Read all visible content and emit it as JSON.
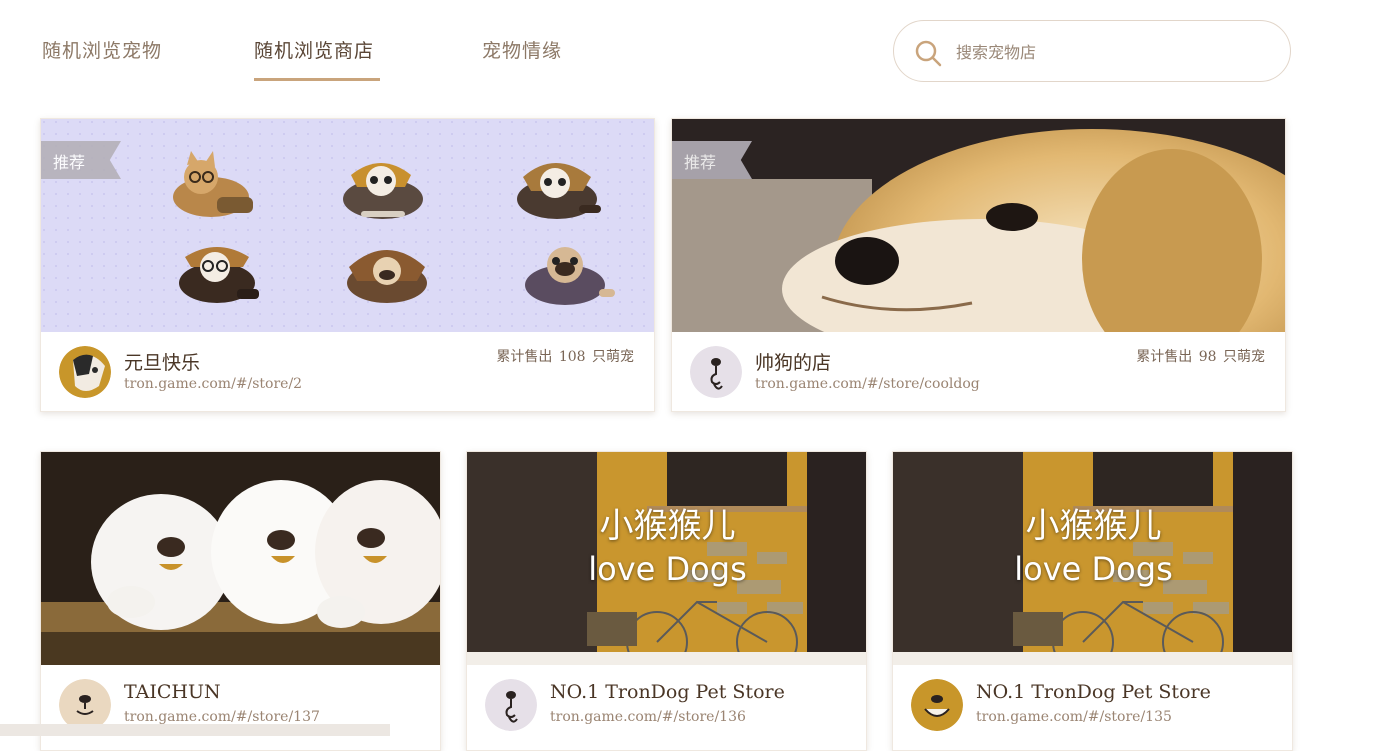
{
  "nav": {
    "tabs": [
      {
        "label": "随机浏览宠物"
      },
      {
        "label": "随机浏览商店"
      },
      {
        "label": "宠物情缘"
      }
    ],
    "active_tab": 1
  },
  "search": {
    "placeholder": "搜索宠物店",
    "value": ""
  },
  "colors": {
    "accent": "#c9a47c",
    "text_dark": "#4a3626",
    "text_muted": "#9a8472",
    "ribbon": "#b4b0b8",
    "lavender_bg": "#dcdaf6",
    "mustard": "#c8962a"
  },
  "stores": [
    {
      "name": "元旦快乐",
      "url": "tron.game.com/#/store/2",
      "sold_prefix": "累计售出",
      "sold_count": "108",
      "sold_suffix": "只萌宠",
      "badge": "推荐",
      "image": "cat-stickers-image",
      "avatar": "dog-avatar-icon"
    },
    {
      "name": "帅狗的店",
      "url": "tron.game.com/#/store/cooldog",
      "sold_prefix": "累计售出",
      "sold_count": "98",
      "sold_suffix": "只萌宠",
      "badge": "推荐",
      "image": "golden-puppy-image",
      "avatar": "dog-nose-icon"
    },
    {
      "name": "TAICHUN",
      "url": "tron.game.com/#/store/137",
      "image": "white-puppies-image",
      "avatar": "dog-face-icon"
    },
    {
      "name": "NO.1 TronDog Pet Store",
      "url": "tron.game.com/#/store/136",
      "image_title_line1": "小猴猴儿",
      "image_title_line2": "love Dogs",
      "image": "yellow-wall-bike-image",
      "avatar": "dog-nose-icon"
    },
    {
      "name": "NO.1 TronDog Pet Store",
      "url": "tron.game.com/#/store/135",
      "image_title_line1": "小猴猴儿",
      "image_title_line2": "love Dogs",
      "image": "yellow-wall-bike-image",
      "avatar": "dog-face-gold-icon"
    }
  ]
}
